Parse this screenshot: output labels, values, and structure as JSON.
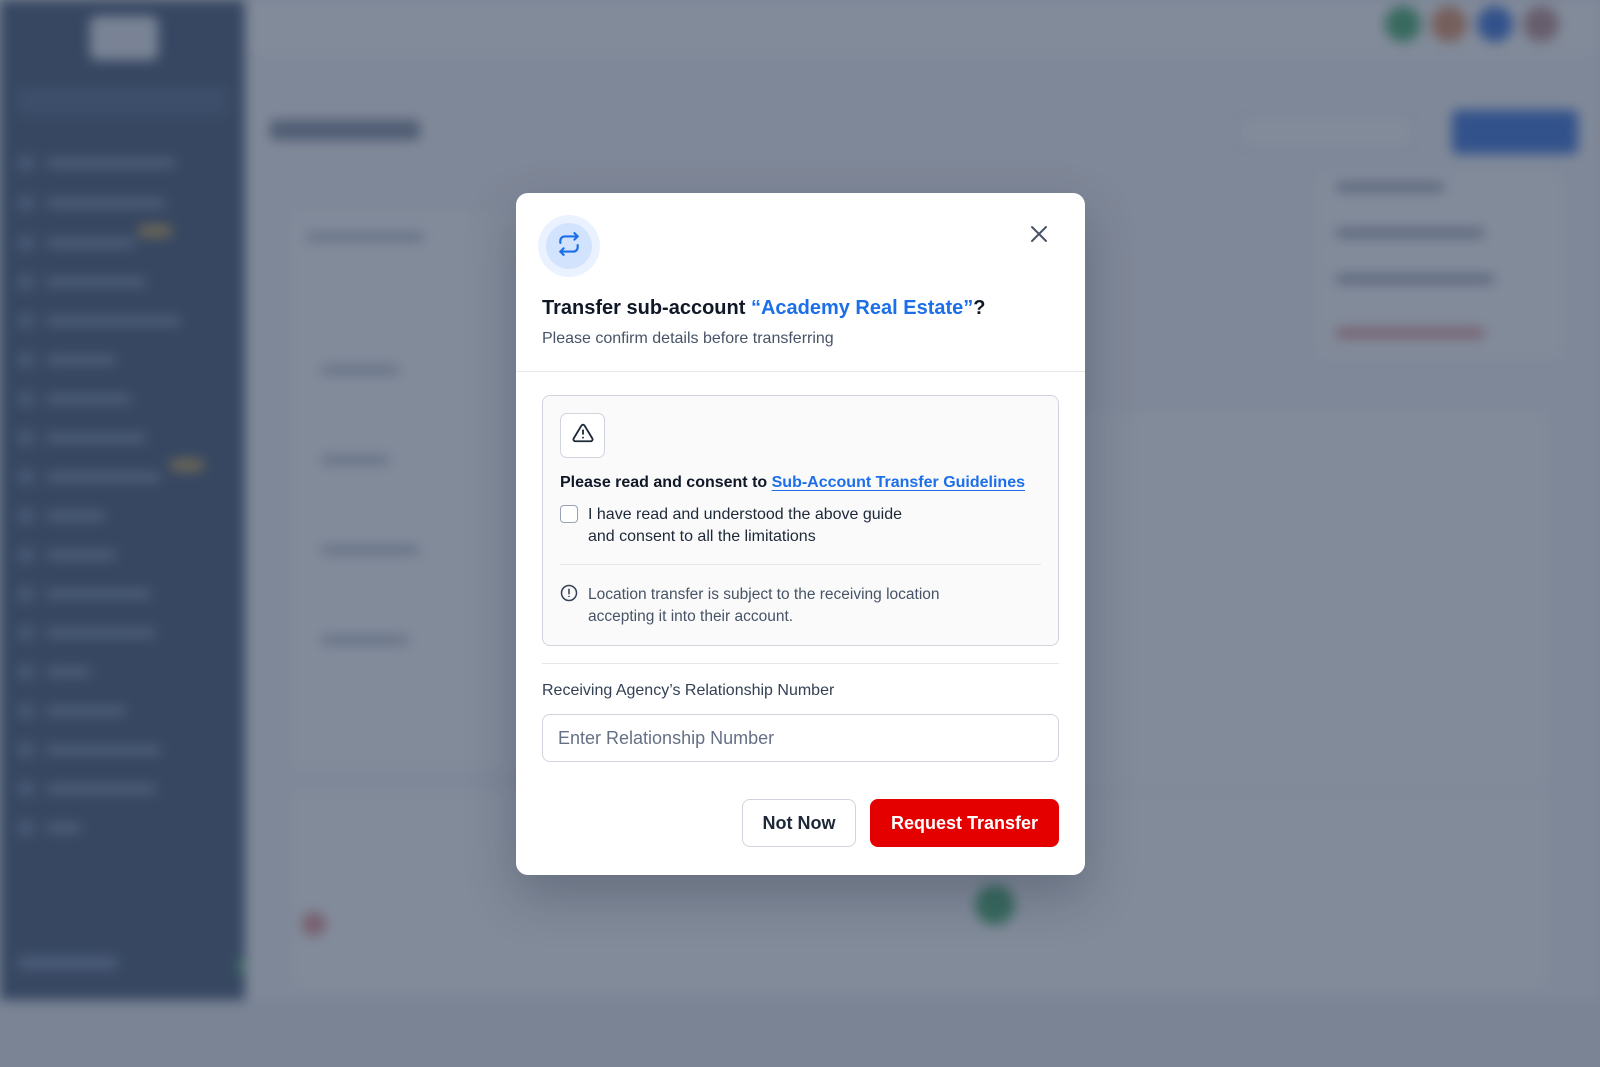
{
  "modal": {
    "title_prefix": "Transfer sub-account ",
    "account_name": "“Academy Real Estate”",
    "title_suffix": "?",
    "subtitle": "Please confirm details before transferring",
    "consent_prefix": "Please read and consent to ",
    "guidelines_link": "Sub-Account Transfer Guidelines",
    "checkbox_label": "I have read and understood the above guide and consent to all the limitations",
    "checkbox_checked": false,
    "note": "Location transfer is subject to the receiving location accepting it into their account.",
    "field_label": "Receiving Agency’s Relationship Number",
    "field_placeholder": "Enter Relationship Number",
    "field_value": "",
    "cancel_label": "Not Now",
    "submit_label": "Request Transfer"
  },
  "icons": {
    "header": "transfer-arrows-icon",
    "close": "close-icon",
    "warning": "warning-triangle-icon",
    "note": "info-circle-icon"
  },
  "colors": {
    "accent": "#1c6fe8",
    "danger": "#e50000",
    "overlay": "#36445c"
  }
}
